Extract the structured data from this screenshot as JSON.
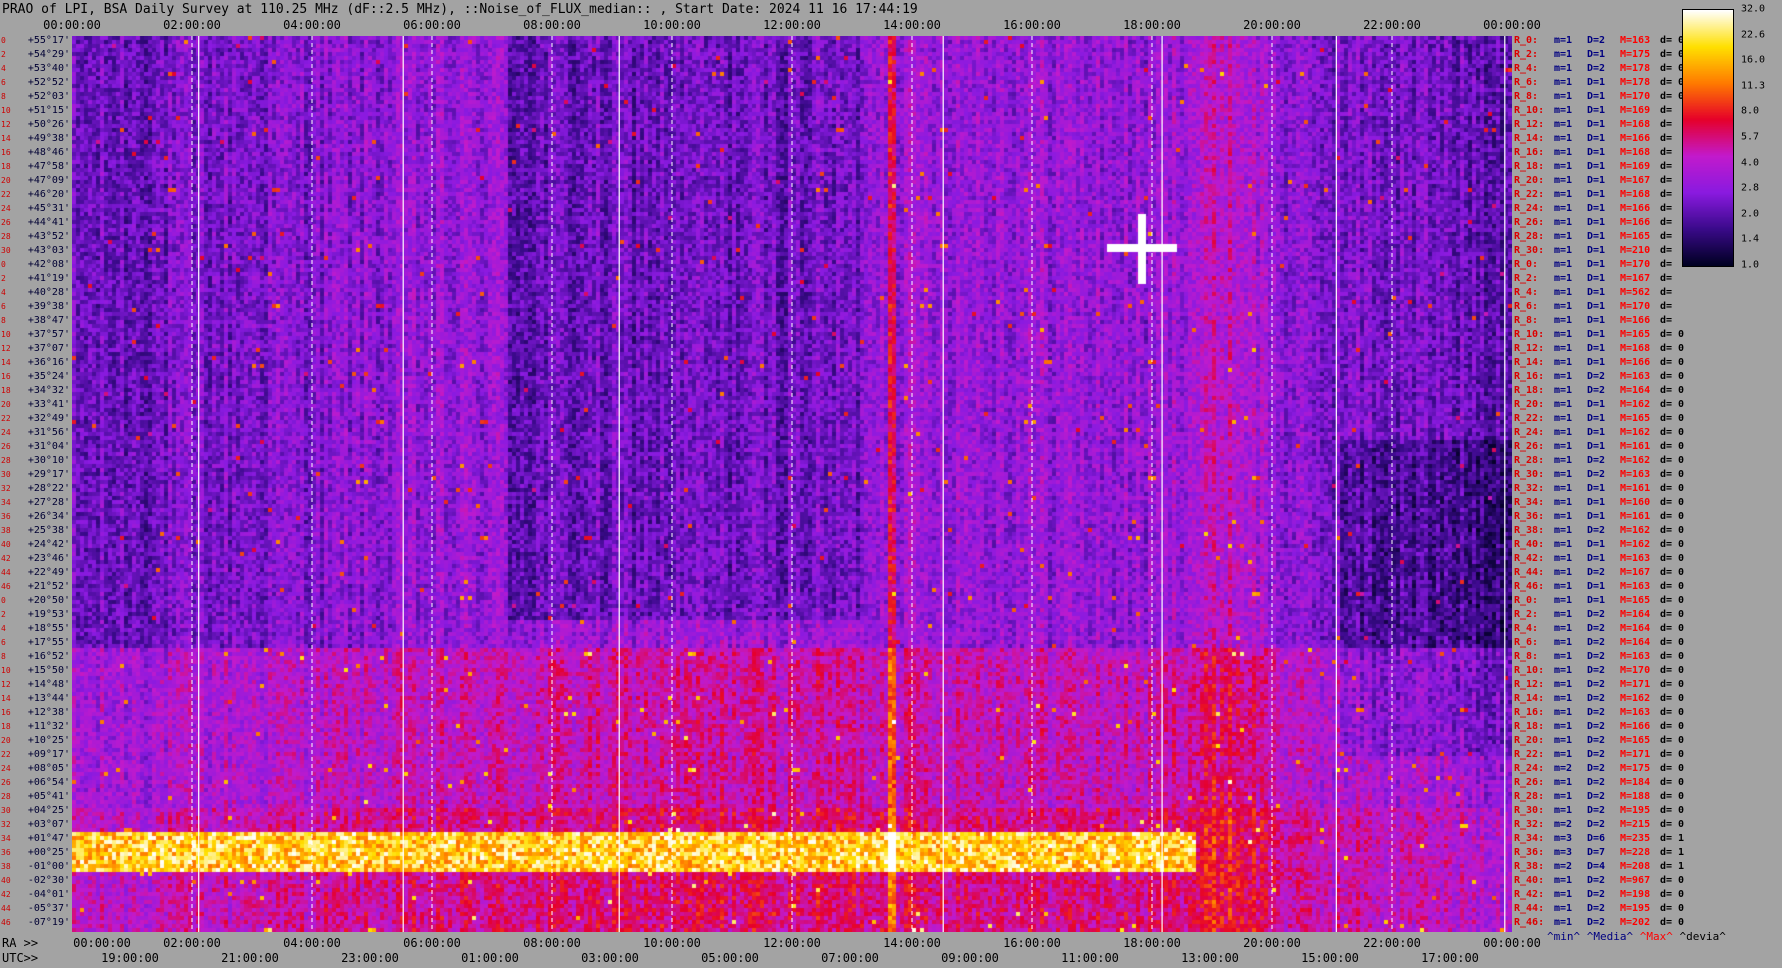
{
  "title": "PRAO of LPI, BSA Daily Survey at 110.25 MHz (dF::2.5 MHz), ::Noise_of_FLUX_median:: , Start Date: 2024 11 16 17:44:19",
  "chart_data": {
    "type": "heatmap",
    "title": "PRAO of LPI, BSA Daily Survey at 110.25 MHz (dF::2.5 MHz), ::Noise_of_FLUX_median:: , Start Date: 2024 11 16 17:44:19",
    "x_top_utc_ticks": [
      "00:00:00",
      "02:00:00",
      "04:00:00",
      "06:00:00",
      "08:00:00",
      "10:00:00",
      "12:00:00",
      "14:00:00",
      "16:00:00",
      "18:00:00",
      "20:00:00",
      "22:00:00",
      "00:00:00"
    ],
    "ra_prefix": "RA >>",
    "x_bottom_ra_ticks": [
      "00:00:00",
      "02:00:00",
      "04:00:00",
      "06:00:00",
      "08:00:00",
      "10:00:00",
      "12:00:00",
      "14:00:00",
      "16:00:00",
      "18:00:00",
      "20:00:00",
      "22:00:00",
      "00:00:00"
    ],
    "utc_prefix": "UTC>>",
    "x_bottom_utc_ticks": [
      "19:00:00",
      "21:00:00",
      "23:00:00",
      "01:00:00",
      "03:00:00",
      "05:00:00",
      "07:00:00",
      "09:00:00",
      "11:00:00",
      "13:00:00",
      "15:00:00",
      "17:00:00"
    ],
    "y_declination_ticks": [
      "+55°17'",
      "+54°29'",
      "+53°40'",
      "+52°52'",
      "+52°03'",
      "+51°15'",
      "+50°26'",
      "+49°38'",
      "+48°46'",
      "+47°58'",
      "+47°09'",
      "+46°20'",
      "+45°31'",
      "+44°41'",
      "+43°52'",
      "+43°03'",
      "+42°08'",
      "+41°19'",
      "+40°28'",
      "+39°38'",
      "+38°47'",
      "+37°57'",
      "+37°07'",
      "+36°16'",
      "+35°24'",
      "+34°32'",
      "+33°41'",
      "+32°49'",
      "+31°56'",
      "+31°04'",
      "+30°10'",
      "+29°17'",
      "+28°22'",
      "+27°28'",
      "+26°34'",
      "+25°38'",
      "+24°42'",
      "+23°46'",
      "+22°49'",
      "+21°52'",
      "+20°50'",
      "+19°53'",
      "+18°55'",
      "+17°55'",
      "+16°52'",
      "+15°50'",
      "+14°48'",
      "+13°44'",
      "+12°38'",
      "+11°32'",
      "+10°25'",
      "+09°17'",
      "+08°05'",
      "+06°54'",
      "+05°41'",
      "+04°25'",
      "+03°07'",
      "+01°47'",
      "+00°25'",
      "-01°00'",
      "-02°30'",
      "-04°01'",
      "-05°37'",
      "-07°19'"
    ],
    "y_index_labels": [
      "0",
      "2",
      "4",
      "6",
      "8",
      "10",
      "12",
      "14",
      "16",
      "18",
      "20",
      "22",
      "24",
      "26",
      "28",
      "30",
      "0",
      "2",
      "4",
      "6",
      "8",
      "10",
      "12",
      "14",
      "16",
      "18",
      "20",
      "22",
      "24",
      "26",
      "28",
      "30",
      "32",
      "34",
      "36",
      "38",
      "40",
      "42",
      "44",
      "46",
      "0",
      "2",
      "4",
      "6",
      "8",
      "10",
      "12",
      "14",
      "16",
      "18",
      "20",
      "22",
      "24",
      "26",
      "28",
      "30",
      "32",
      "34",
      "36",
      "38",
      "40",
      "42",
      "44",
      "46"
    ],
    "colorbar": {
      "ticks": [
        "32.0",
        "22.6",
        "16.0",
        "11.3",
        "8.0",
        "5.7",
        "4.0",
        "2.8",
        "2.0",
        "1.4",
        "1.0"
      ],
      "scale": "log2",
      "min": 1.0,
      "max": 32.0
    },
    "legend": [
      "^min^",
      "^Media^",
      "^Max^",
      "^devia^"
    ],
    "row_stats": [
      {
        "r": "R_0:",
        "m": "m=1",
        "d": "D=2",
        "max": "M=163",
        "dev": "d= 0"
      },
      {
        "r": "R_2:",
        "m": "m=1",
        "d": "D=1",
        "max": "M=175",
        "dev": "d= 0"
      },
      {
        "r": "R_4:",
        "m": "m=1",
        "d": "D=2",
        "max": "M=178",
        "dev": "d= 0"
      },
      {
        "r": "R_6:",
        "m": "m=1",
        "d": "D=1",
        "max": "M=178",
        "dev": "d= 0"
      },
      {
        "r": "R_8:",
        "m": "m=1",
        "d": "D=1",
        "max": "M=170",
        "dev": "d= 0"
      },
      {
        "r": "R_10:",
        "m": "m=1",
        "d": "D=1",
        "max": "M=169",
        "dev": "d="
      },
      {
        "r": "R_12:",
        "m": "m=1",
        "d": "D=1",
        "max": "M=168",
        "dev": "d="
      },
      {
        "r": "R_14:",
        "m": "m=1",
        "d": "D=1",
        "max": "M=166",
        "dev": "d="
      },
      {
        "r": "R_16:",
        "m": "m=1",
        "d": "D=1",
        "max": "M=168",
        "dev": "d="
      },
      {
        "r": "R_18:",
        "m": "m=1",
        "d": "D=1",
        "max": "M=169",
        "dev": "d="
      },
      {
        "r": "R_20:",
        "m": "m=1",
        "d": "D=1",
        "max": "M=167",
        "dev": "d="
      },
      {
        "r": "R_22:",
        "m": "m=1",
        "d": "D=1",
        "max": "M=168",
        "dev": "d="
      },
      {
        "r": "R_24:",
        "m": "m=1",
        "d": "D=1",
        "max": "M=166",
        "dev": "d="
      },
      {
        "r": "R_26:",
        "m": "m=1",
        "d": "D=1",
        "max": "M=166",
        "dev": "d="
      },
      {
        "r": "R_28:",
        "m": "m=1",
        "d": "D=1",
        "max": "M=165",
        "dev": "d="
      },
      {
        "r": "R_30:",
        "m": "m=1",
        "d": "D=1",
        "max": "M=210",
        "dev": "d="
      },
      {
        "r": "R_0:",
        "m": "m=1",
        "d": "D=1",
        "max": "M=170",
        "dev": "d="
      },
      {
        "r": "R_2:",
        "m": "m=1",
        "d": "D=1",
        "max": "M=167",
        "dev": "d="
      },
      {
        "r": "R_4:",
        "m": "m=1",
        "d": "D=1",
        "max": "M=562",
        "dev": "d="
      },
      {
        "r": "R_6:",
        "m": "m=1",
        "d": "D=1",
        "max": "M=170",
        "dev": "d="
      },
      {
        "r": "R_8:",
        "m": "m=1",
        "d": "D=1",
        "max": "M=166",
        "dev": "d="
      },
      {
        "r": "R_10:",
        "m": "m=1",
        "d": "D=1",
        "max": "M=165",
        "dev": "d= 0"
      },
      {
        "r": "R_12:",
        "m": "m=1",
        "d": "D=1",
        "max": "M=168",
        "dev": "d= 0"
      },
      {
        "r": "R_14:",
        "m": "m=1",
        "d": "D=1",
        "max": "M=166",
        "dev": "d= 0"
      },
      {
        "r": "R_16:",
        "m": "m=1",
        "d": "D=2",
        "max": "M=163",
        "dev": "d= 0"
      },
      {
        "r": "R_18:",
        "m": "m=1",
        "d": "D=2",
        "max": "M=164",
        "dev": "d= 0"
      },
      {
        "r": "R_20:",
        "m": "m=1",
        "d": "D=1",
        "max": "M=162",
        "dev": "d= 0"
      },
      {
        "r": "R_22:",
        "m": "m=1",
        "d": "D=1",
        "max": "M=165",
        "dev": "d= 0"
      },
      {
        "r": "R_24:",
        "m": "m=1",
        "d": "D=1",
        "max": "M=162",
        "dev": "d= 0"
      },
      {
        "r": "R_26:",
        "m": "m=1",
        "d": "D=1",
        "max": "M=161",
        "dev": "d= 0"
      },
      {
        "r": "R_28:",
        "m": "m=1",
        "d": "D=2",
        "max": "M=162",
        "dev": "d= 0"
      },
      {
        "r": "R_30:",
        "m": "m=1",
        "d": "D=2",
        "max": "M=163",
        "dev": "d= 0"
      },
      {
        "r": "R_32:",
        "m": "m=1",
        "d": "D=1",
        "max": "M=161",
        "dev": "d= 0"
      },
      {
        "r": "R_34:",
        "m": "m=1",
        "d": "D=1",
        "max": "M=160",
        "dev": "d= 0"
      },
      {
        "r": "R_36:",
        "m": "m=1",
        "d": "D=1",
        "max": "M=161",
        "dev": "d= 0"
      },
      {
        "r": "R_38:",
        "m": "m=1",
        "d": "D=2",
        "max": "M=162",
        "dev": "d= 0"
      },
      {
        "r": "R_40:",
        "m": "m=1",
        "d": "D=1",
        "max": "M=162",
        "dev": "d= 0"
      },
      {
        "r": "R_42:",
        "m": "m=1",
        "d": "D=1",
        "max": "M=163",
        "dev": "d= 0"
      },
      {
        "r": "R_44:",
        "m": "m=1",
        "d": "D=2",
        "max": "M=167",
        "dev": "d= 0"
      },
      {
        "r": "R_46:",
        "m": "m=1",
        "d": "D=1",
        "max": "M=163",
        "dev": "d= 0"
      },
      {
        "r": "R_0:",
        "m": "m=1",
        "d": "D=1",
        "max": "M=165",
        "dev": "d= 0"
      },
      {
        "r": "R_2:",
        "m": "m=1",
        "d": "D=2",
        "max": "M=164",
        "dev": "d= 0"
      },
      {
        "r": "R_4:",
        "m": "m=1",
        "d": "D=2",
        "max": "M=164",
        "dev": "d= 0"
      },
      {
        "r": "R_6:",
        "m": "m=1",
        "d": "D=2",
        "max": "M=164",
        "dev": "d= 0"
      },
      {
        "r": "R_8:",
        "m": "m=1",
        "d": "D=2",
        "max": "M=163",
        "dev": "d= 0"
      },
      {
        "r": "R_10:",
        "m": "m=1",
        "d": "D=2",
        "max": "M=170",
        "dev": "d= 0"
      },
      {
        "r": "R_12:",
        "m": "m=1",
        "d": "D=2",
        "max": "M=171",
        "dev": "d= 0"
      },
      {
        "r": "R_14:",
        "m": "m=1",
        "d": "D=2",
        "max": "M=162",
        "dev": "d= 0"
      },
      {
        "r": "R_16:",
        "m": "m=1",
        "d": "D=2",
        "max": "M=163",
        "dev": "d= 0"
      },
      {
        "r": "R_18:",
        "m": "m=1",
        "d": "D=2",
        "max": "M=166",
        "dev": "d= 0"
      },
      {
        "r": "R_20:",
        "m": "m=1",
        "d": "D=2",
        "max": "M=165",
        "dev": "d= 0"
      },
      {
        "r": "R_22:",
        "m": "m=1",
        "d": "D=2",
        "max": "M=171",
        "dev": "d= 0"
      },
      {
        "r": "R_24:",
        "m": "m=2",
        "d": "D=2",
        "max": "M=175",
        "dev": "d= 0"
      },
      {
        "r": "R_26:",
        "m": "m=1",
        "d": "D=2",
        "max": "M=184",
        "dev": "d= 0"
      },
      {
        "r": "R_28:",
        "m": "m=1",
        "d": "D=2",
        "max": "M=188",
        "dev": "d= 0"
      },
      {
        "r": "R_30:",
        "m": "m=1",
        "d": "D=2",
        "max": "M=195",
        "dev": "d= 0"
      },
      {
        "r": "R_32:",
        "m": "m=2",
        "d": "D=2",
        "max": "M=215",
        "dev": "d= 0"
      },
      {
        "r": "R_34:",
        "m": "m=3",
        "d": "D=6",
        "max": "M=235",
        "dev": "d= 1"
      },
      {
        "r": "R_36:",
        "m": "m=3",
        "d": "D=7",
        "max": "M=228",
        "dev": "d= 1"
      },
      {
        "r": "R_38:",
        "m": "m=2",
        "d": "D=4",
        "max": "M=208",
        "dev": "d= 1"
      },
      {
        "r": "R_40:",
        "m": "m=1",
        "d": "D=2",
        "max": "M=967",
        "dev": "d= 0"
      },
      {
        "r": "R_42:",
        "m": "m=1",
        "d": "D=2",
        "max": "M=198",
        "dev": "d= 0"
      },
      {
        "r": "R_44:",
        "m": "m=1",
        "d": "D=2",
        "max": "M=195",
        "dev": "d= 0"
      },
      {
        "r": "R_46:",
        "m": "m=1",
        "d": "D=2",
        "max": "M=202",
        "dev": "d= 0"
      }
    ],
    "colors": {
      "background": "#a3a3a3",
      "colormap": [
        "#000022",
        "#3a0a8a",
        "#8a1ae0",
        "#c21acc",
        "#e6002a",
        "#ff7a00",
        "#ffe000",
        "#ffffff"
      ]
    }
  }
}
